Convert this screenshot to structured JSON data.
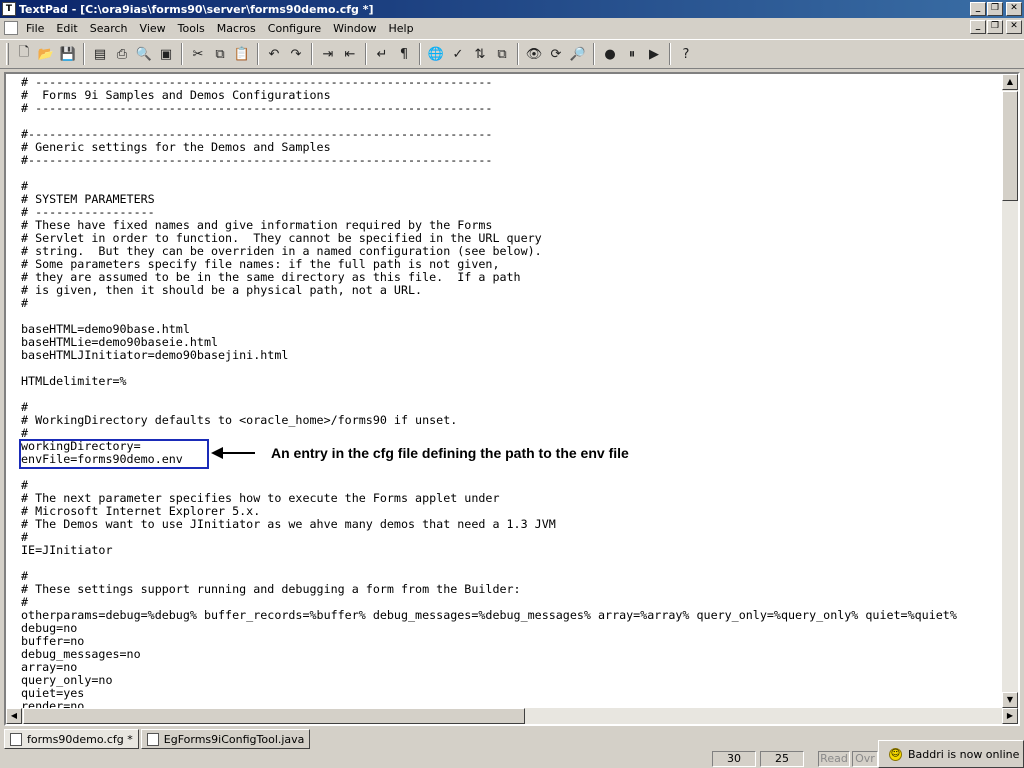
{
  "window": {
    "title": "TextPad - [C:\\ora9ias\\forms90\\server\\forms90demo.cfg *]",
    "buttons": [
      "_",
      "❐",
      "✕"
    ]
  },
  "menubar": {
    "items": [
      "File",
      "Edit",
      "Search",
      "View",
      "Tools",
      "Macros",
      "Configure",
      "Window",
      "Help"
    ]
  },
  "toolbar": {
    "buttons": [
      "new-icon",
      "open-icon",
      "save-icon",
      "save-all-icon",
      "print-icon",
      "print-preview-icon",
      "properties-icon",
      "cut-icon",
      "copy-icon",
      "paste-icon",
      "undo-icon",
      "redo-icon",
      "indent-icon",
      "outdent-icon",
      "word-wrap-icon",
      "paragraph-icon",
      "browser-icon",
      "spelling-icon",
      "sort-icon",
      "compare-icon",
      "find-icon",
      "replace-icon",
      "find-in-files-icon",
      "record-macro-icon",
      "pause-macro-icon",
      "play-macro-icon",
      "help-icon"
    ]
  },
  "editor": {
    "lines": [
      "# -----------------------------------------------------------------",
      "#  Forms 9i Samples and Demos Configurations",
      "# -----------------------------------------------------------------",
      "",
      "#------------------------------------------------------------------",
      "# Generic settings for the Demos and Samples",
      "#------------------------------------------------------------------",
      "",
      "#",
      "# SYSTEM PARAMETERS",
      "# -----------------",
      "# These have fixed names and give information required by the Forms",
      "# Servlet in order to function.  They cannot be specified in the URL query",
      "# string.  But they can be overriden in a named configuration (see below).",
      "# Some parameters specify file names: if the full path is not given,",
      "# they are assumed to be in the same directory as this file.  If a path",
      "# is given, then it should be a physical path, not a URL.",
      "#",
      "",
      "baseHTML=demo90base.html",
      "baseHTMLie=demo90baseie.html",
      "baseHTMLJInitiator=demo90basejini.html",
      "",
      "HTMLdelimiter=%",
      "",
      "#",
      "# WorkingDirectory defaults to <oracle_home>/forms90 if unset.",
      "#",
      "workingDirectory=",
      "envFile=forms90demo.env",
      "",
      "#",
      "# The next parameter specifies how to execute the Forms applet under",
      "# Microsoft Internet Explorer 5.x.",
      "# The Demos want to use JInitiator as we ahve many demos that need a 1.3 JVM",
      "#",
      "IE=JInitiator",
      "",
      "#",
      "# These settings support running and debugging a form from the Builder:",
      "#",
      "otherparams=debug=%debug% buffer_records=%buffer% debug_messages=%debug_messages% array=%array% query_only=%query_only% quiet=%quiet%",
      "debug=no",
      "buffer=no",
      "debug_messages=no",
      "array=no",
      "query_only=no",
      "quiet=yes",
      "render=no"
    ]
  },
  "annotation": {
    "text": "An entry in the cfg file defining the path to the env file"
  },
  "tabs": [
    {
      "label": "forms90demo.cfg *"
    },
    {
      "label": "EgForms9iConfigTool.java"
    }
  ],
  "status": {
    "line": "30",
    "column": "25",
    "read": "Read",
    "ovr": "Ovr"
  },
  "notification": {
    "text": "Baddri is now online"
  }
}
